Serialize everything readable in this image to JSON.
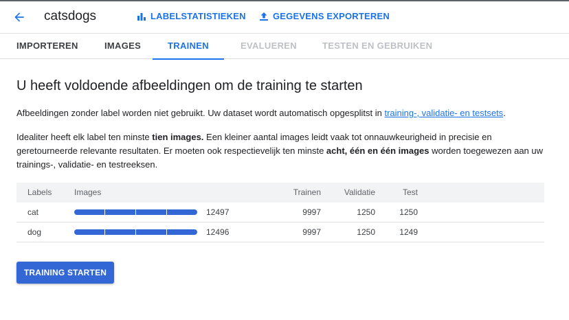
{
  "header": {
    "dataset_name": "catsdogs",
    "actions": [
      {
        "label": "LABELSTATISTIEKEN",
        "icon": "bar-chart-icon"
      },
      {
        "label": "GEGEVENS EXPORTEREN",
        "icon": "export-icon"
      }
    ]
  },
  "tabs": [
    {
      "label": "IMPORTEREN",
      "state": "done"
    },
    {
      "label": "IMAGES",
      "state": "done"
    },
    {
      "label": "TRAINEN",
      "state": "active"
    },
    {
      "label": "EVALUEREN",
      "state": "disabled"
    },
    {
      "label": "TESTEN EN GEBRUIKEN",
      "state": "disabled"
    }
  ],
  "main": {
    "heading": "U heeft voldoende afbeeldingen om de training te starten",
    "p1_text": "Afbeeldingen zonder label worden niet gebruikt. Uw dataset wordt automatisch opgesplitst in ",
    "p1_link": "training-, validatie- en testsets",
    "p1_end": ".",
    "p2_a": "Idealiter heeft elk label ten minste ",
    "p2_b": "tien images.",
    "p2_c": " Een kleiner aantal images leidt vaak tot onnauwkeurigheid in precisie en geretourneerde relevante resultaten. Er moeten ook respectievelijk ten minste ",
    "p2_d": "acht, één en één images",
    "p2_e": " worden toegewezen aan uw trainings-, validatie- en testreeksen."
  },
  "table": {
    "headers": {
      "labels": "Labels",
      "images": "Images",
      "trainen": "Trainen",
      "validatie": "Validatie",
      "test": "Test"
    },
    "rows": [
      {
        "label": "cat",
        "images": "12497",
        "trainen": "9997",
        "validatie": "1250",
        "test": "1250"
      },
      {
        "label": "dog",
        "images": "12496",
        "trainen": "9997",
        "validatie": "1250",
        "test": "1249"
      }
    ]
  },
  "start_button": "TRAINING STARTEN",
  "colors": {
    "accent": "#1a73e8",
    "button": "#3367d6",
    "bar": "#3367d6"
  }
}
